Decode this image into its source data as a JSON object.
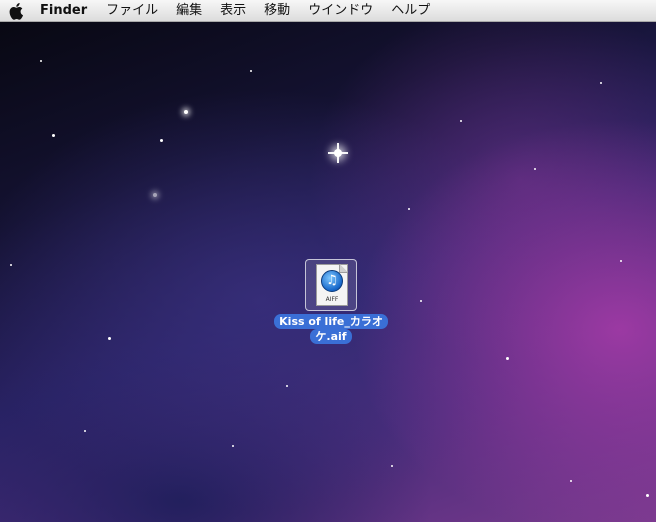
{
  "menubar": {
    "app_name": "Finder",
    "items": [
      "ファイル",
      "編集",
      "表示",
      "移動",
      "ウインドウ",
      "ヘルプ"
    ]
  },
  "desktop": {
    "file": {
      "name": "Kiss of life_カラオケ.aif",
      "type_label": "AIFF",
      "icon": "aiff-music-file-icon"
    }
  }
}
